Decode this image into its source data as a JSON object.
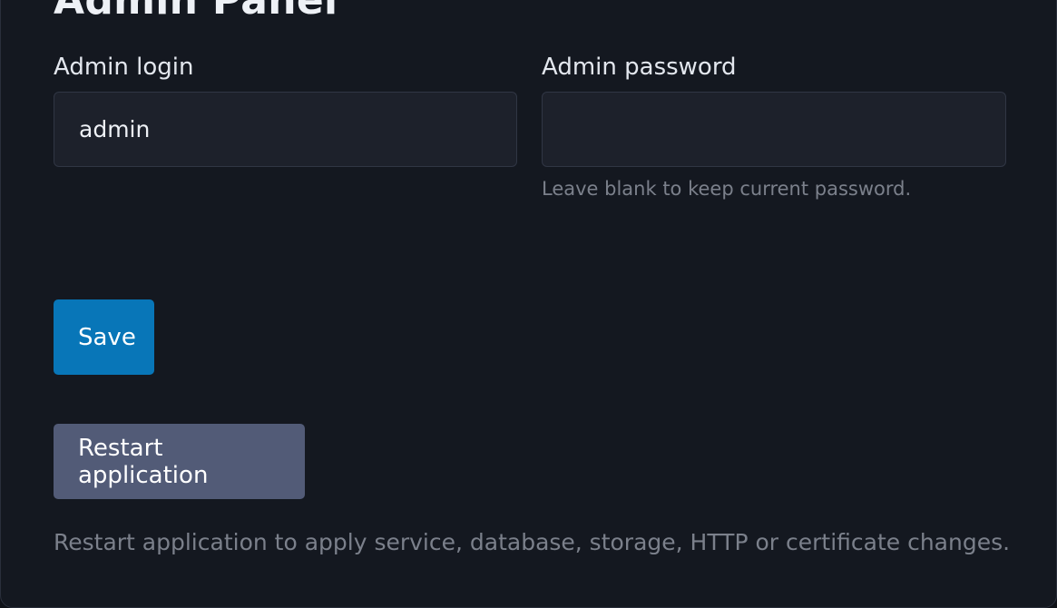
{
  "panel": {
    "title": "Admin Panel"
  },
  "form": {
    "login": {
      "label": "Admin login",
      "value": "admin",
      "placeholder": ""
    },
    "password": {
      "label": "Admin password",
      "value": "",
      "placeholder": "",
      "hint": "Leave blank to keep current password."
    },
    "save_label": "Save"
  },
  "restart": {
    "label": "Restart application",
    "hint": "Restart application to apply service, database, storage, HTTP or certificate changes."
  },
  "colors": {
    "page_bg": "#141820",
    "input_bg": "#1d212b",
    "save_button": "#0876b8",
    "restart_button": "#525b77",
    "hint_text": "#7b808b"
  }
}
